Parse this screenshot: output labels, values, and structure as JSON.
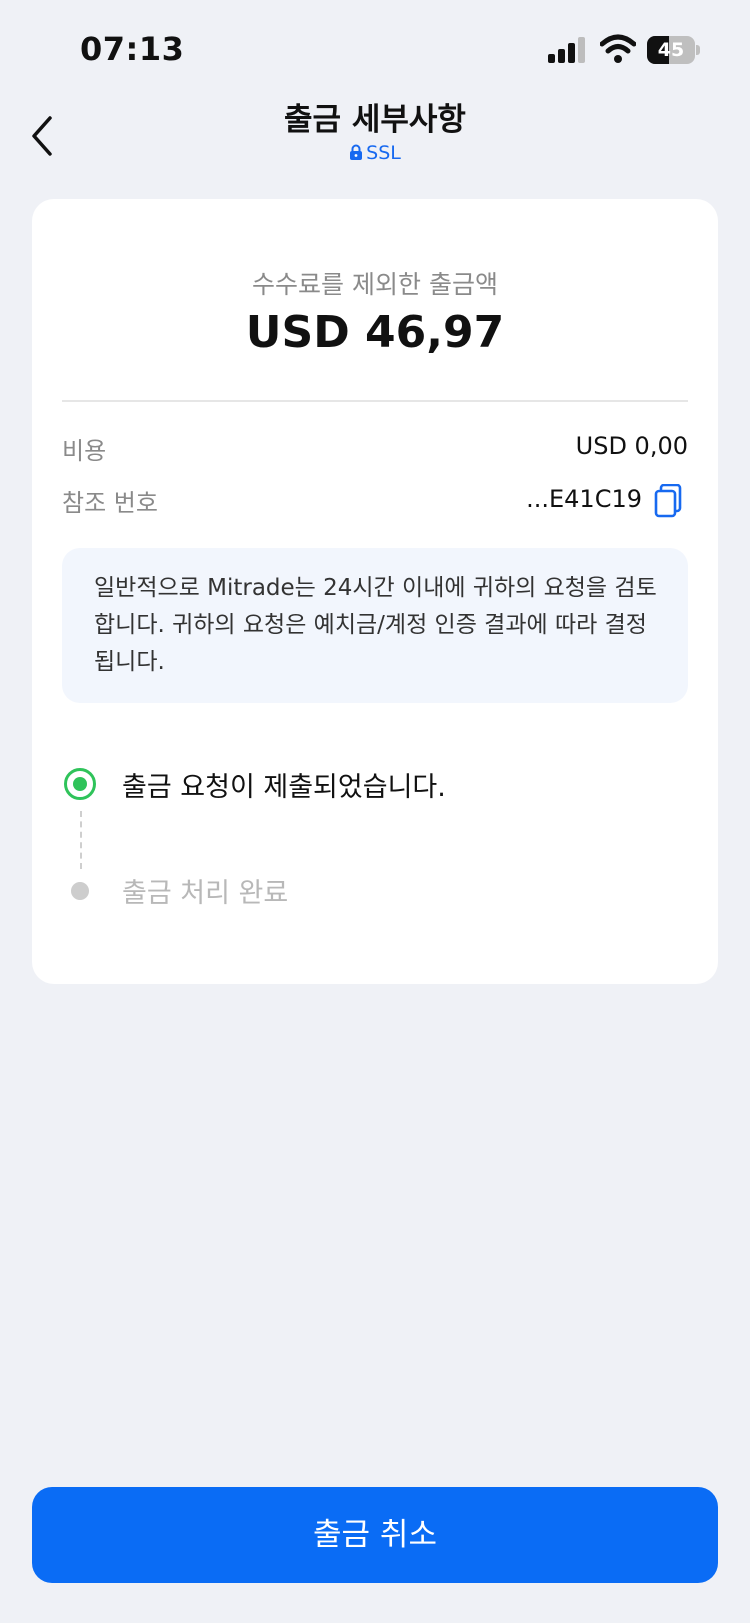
{
  "status_bar": {
    "time": "07:13",
    "battery_level": "45",
    "battery_percent": 45
  },
  "header": {
    "title": "출금 세부사항",
    "security_label": "SSL",
    "accent_color": "#1769f0"
  },
  "summary": {
    "net_amount_label": "수수료를 제외한 출금액",
    "net_amount": "USD 46,97",
    "fee_label": "비용",
    "fee_value": "USD 0,00",
    "reference_label": "참조 번호",
    "reference_value": "...E41C19"
  },
  "notice": {
    "text": "일반적으로 Mitrade는 24시간 이내에 귀하의 요청을 검토합니다. 귀하의 요청은 예치금/계정 인증 결과에 따라 결정됩니다."
  },
  "progress": {
    "steps": [
      {
        "label": "출금 요청이 제출되었습니다.",
        "status": "completed",
        "color": "#2fc35a"
      },
      {
        "label": "출금 처리 완료",
        "status": "pending",
        "color": "#cdcdcd"
      }
    ]
  },
  "actions": {
    "cancel_label": "출금 취소",
    "button_color": "#0a6cf5"
  }
}
